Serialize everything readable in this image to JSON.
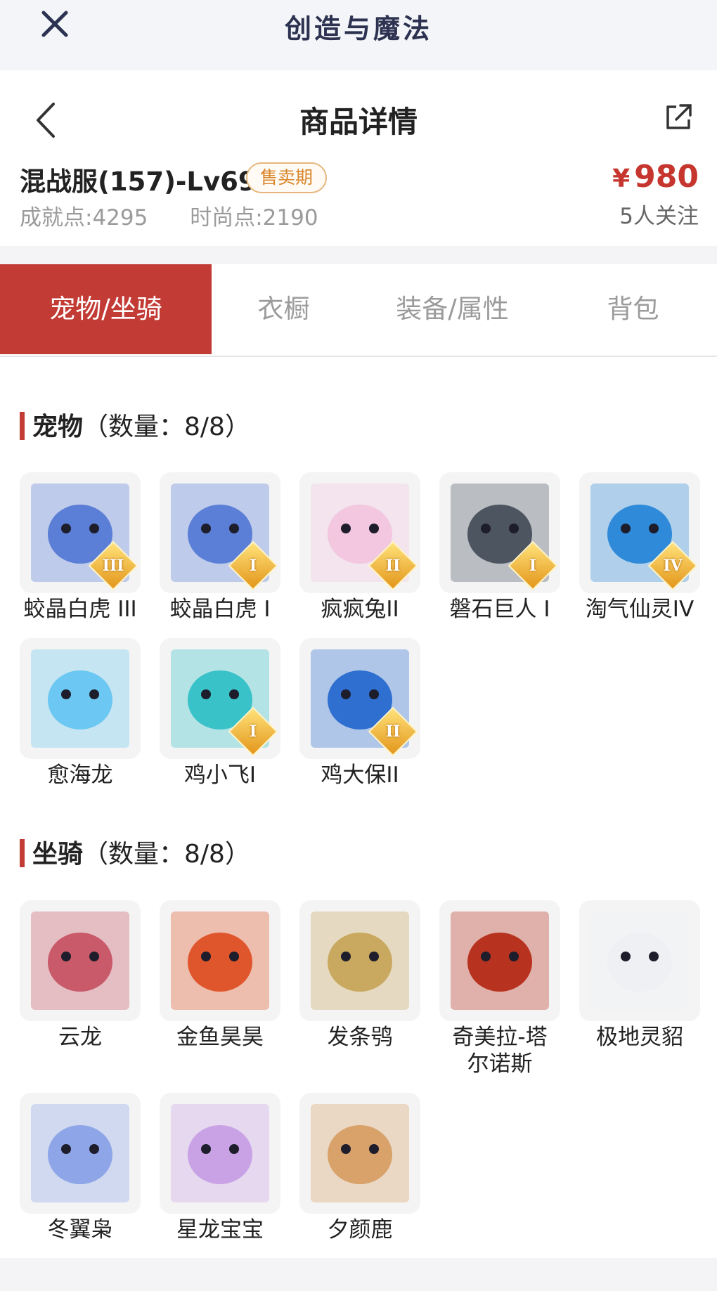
{
  "app": {
    "title": "创造与魔法"
  },
  "header": {
    "title": "商品详情",
    "server_name": "混战服(157)-Lv69",
    "status_badge": "售卖期",
    "achievement": "成就点:4295",
    "fashion": "时尚点:2190",
    "price_currency": "¥",
    "price_value": "980",
    "followers": "5人关注"
  },
  "tabs": [
    {
      "label": "宠物/坐骑",
      "active": true
    },
    {
      "label": "衣橱",
      "active": false
    },
    {
      "label": "装备/属性",
      "active": false
    },
    {
      "label": "背包",
      "active": false
    }
  ],
  "pets": {
    "title": "宠物",
    "count": "（数量：8/8）",
    "items": [
      {
        "name": "蛟晶白虎 III",
        "badge": "III",
        "icon": "white-tiger-icon",
        "color": "#5b7fd6"
      },
      {
        "name": "蛟晶白虎 I",
        "badge": "I",
        "icon": "white-tiger-icon",
        "color": "#5b7fd6"
      },
      {
        "name": "疯疯兔II",
        "badge": "II",
        "icon": "rabbit-icon",
        "color": "#f2c7df"
      },
      {
        "name": "磐石巨人 I",
        "badge": "I",
        "icon": "stone-giant-icon",
        "color": "#4d5560"
      },
      {
        "name": "淘气仙灵IV",
        "badge": "IV",
        "icon": "blue-spirit-icon",
        "color": "#2f8ad9"
      },
      {
        "name": "愈海龙",
        "badge": "",
        "icon": "sea-dragon-icon",
        "color": "#6cc8f2"
      },
      {
        "name": "鸡小飞I",
        "badge": "I",
        "icon": "chick-icon",
        "color": "#39c2c8"
      },
      {
        "name": "鸡大保II",
        "badge": "II",
        "icon": "rooster-icon",
        "color": "#2f6fd0"
      }
    ]
  },
  "mounts": {
    "title": "坐骑",
    "count": "（数量：8/8）",
    "items": [
      {
        "name": "云龙",
        "icon": "cloud-dragon-icon",
        "color": "#c95a6a"
      },
      {
        "name": "金鱼昊昊",
        "icon": "goldfish-icon",
        "color": "#e0562c"
      },
      {
        "name": "发条鸮",
        "icon": "clockwork-owl-icon",
        "color": "#c9a860"
      },
      {
        "name": "奇美拉-塔尔诺斯",
        "icon": "chimera-icon",
        "color": "#b8331f"
      },
      {
        "name": "极地灵貂",
        "icon": "polar-ferret-icon",
        "color": "#eef0f4"
      },
      {
        "name": "冬翼枭",
        "icon": "winter-owl-icon",
        "color": "#8ea6e8"
      },
      {
        "name": "星龙宝宝",
        "icon": "star-dragon-icon",
        "color": "#c9a2e6"
      },
      {
        "name": "夕颜鹿",
        "icon": "deer-icon",
        "color": "#d8a26a"
      }
    ]
  }
}
